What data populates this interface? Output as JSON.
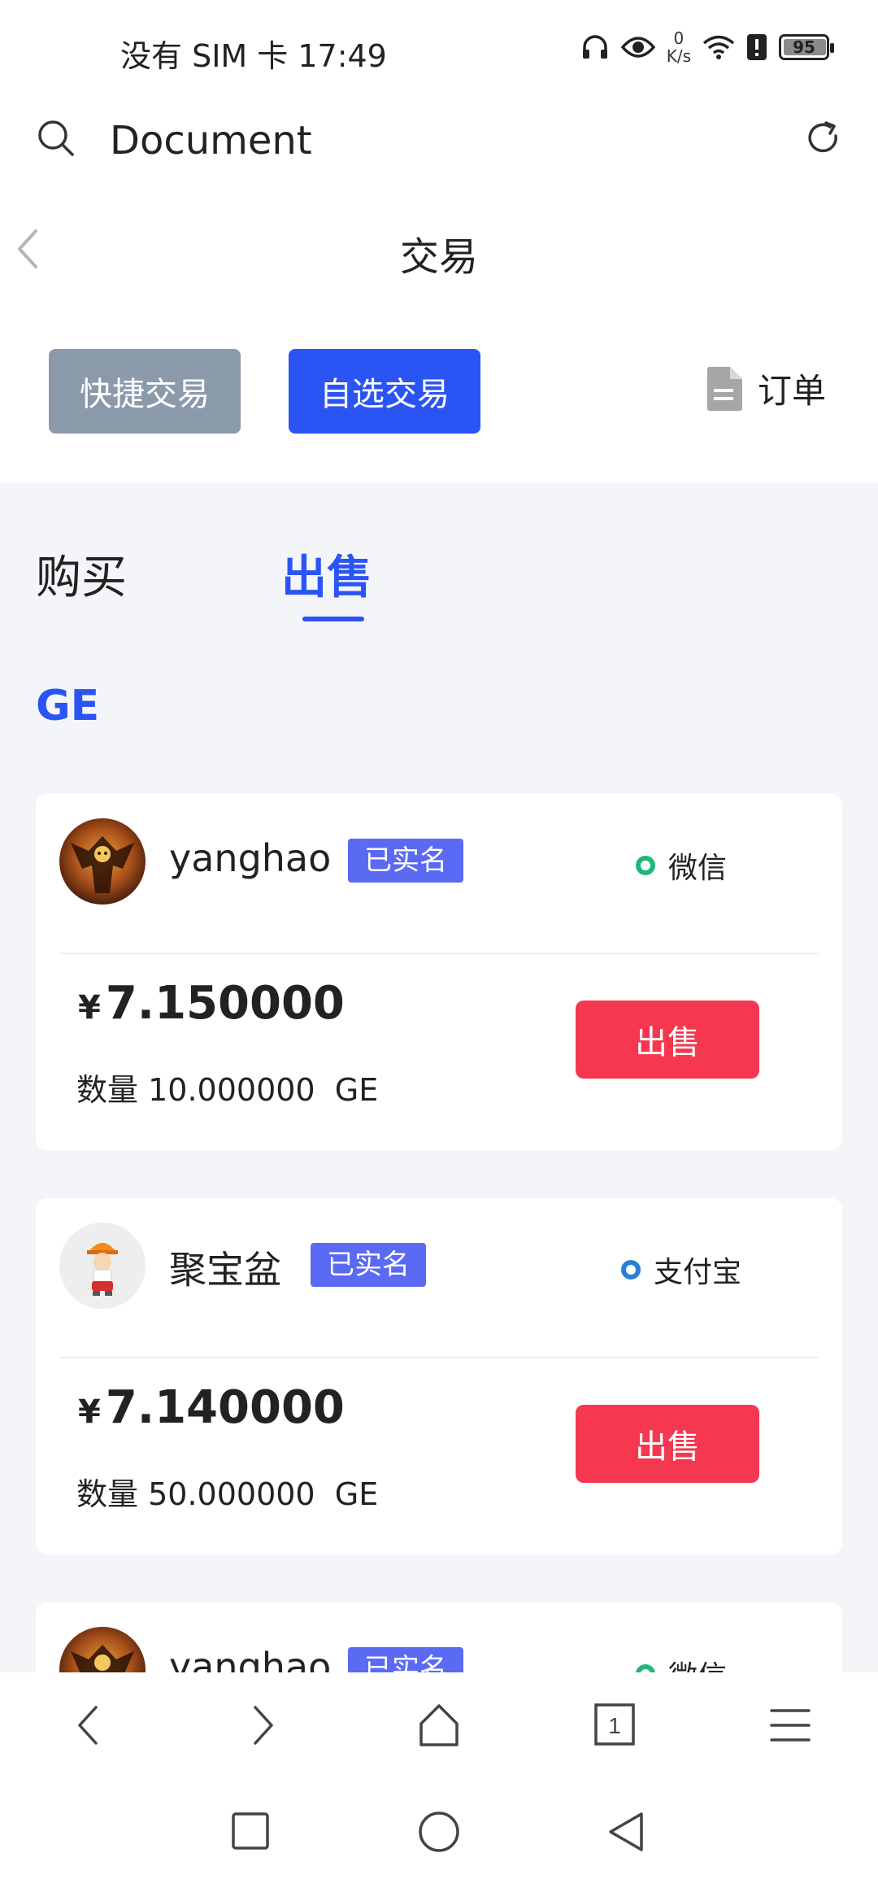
{
  "status_bar": {
    "left_text": "没有 SIM 卡 17:49",
    "net_speed_value": "0",
    "net_speed_unit": "K/s",
    "battery_level": "95",
    "icons": [
      "headphones-icon",
      "eye-icon",
      "wifi-icon",
      "alert-icon",
      "battery-icon"
    ]
  },
  "browser": {
    "title": "Document",
    "search_icon": "search-icon",
    "refresh_icon": "refresh-icon"
  },
  "header": {
    "title": "交易",
    "back_icon": "chevron-left-icon"
  },
  "modes": {
    "quick_label": "快捷交易",
    "custom_label": "自选交易",
    "orders_label": "订单",
    "orders_icon": "document-icon"
  },
  "tabs": {
    "buy_label": "购买",
    "sell_label": "出售",
    "active": "sell"
  },
  "coin": "GE",
  "listings": [
    {
      "name": "yanghao",
      "verified_label": "已实名",
      "payment": "微信",
      "payment_color": "#1fb67a",
      "currency_symbol": "¥",
      "price": "7.150000",
      "quantity_label": "数量",
      "quantity": "10.000000",
      "unit": "GE",
      "action_label": "出售"
    },
    {
      "name": "聚宝盆",
      "verified_label": "已实名",
      "payment": "支付宝",
      "payment_color": "#2a7fd4",
      "currency_symbol": "¥",
      "price": "7.140000",
      "quantity_label": "数量",
      "quantity": "50.000000",
      "unit": "GE",
      "action_label": "出售"
    },
    {
      "name": "yanghao",
      "verified_label": "已实名",
      "payment": "微信",
      "payment_color": "#1fb67a"
    }
  ],
  "browser_nav": {
    "tab_count": "1",
    "icons": [
      "back-icon",
      "forward-icon",
      "home-icon",
      "tabs-icon",
      "menu-icon"
    ]
  },
  "colors": {
    "accent": "#2b54f5",
    "sell": "#f5384f",
    "verified": "#5b6af2",
    "muted_button": "#8b9aab",
    "background": "#f3f5f9"
  }
}
